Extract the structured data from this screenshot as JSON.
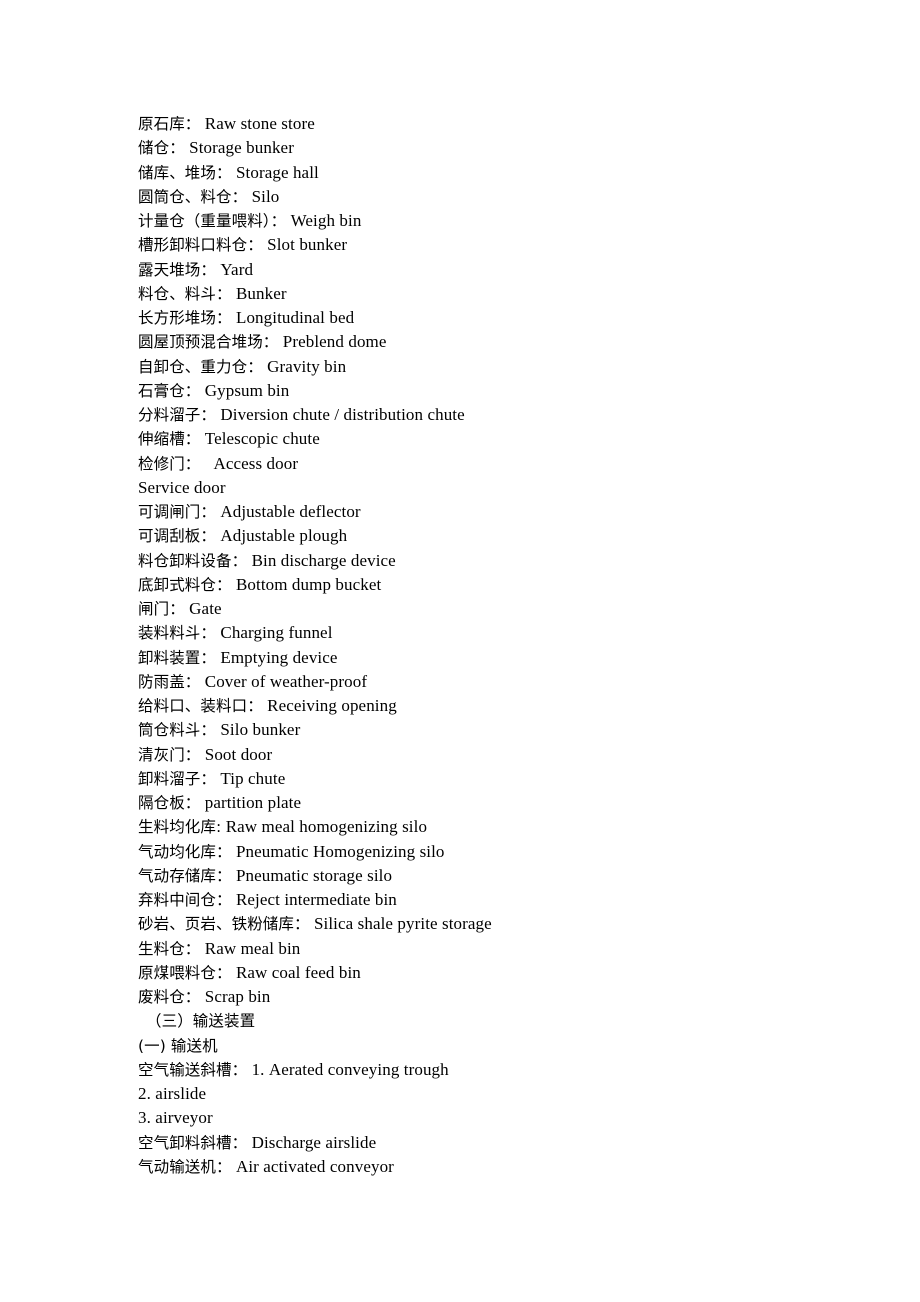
{
  "document": {
    "background_color": "#ffffff",
    "text_color": "#000000",
    "lines": [
      {
        "cn": "原石库：",
        "en": "Raw stone store",
        "indent": false
      },
      {
        "cn": "储仓：",
        "en": "Storage bunker",
        "indent": false
      },
      {
        "cn": "储库、堆场：",
        "en": "Storage hall",
        "indent": false
      },
      {
        "cn": "圆筒仓、料仓：",
        "en": "Silo",
        "indent": false
      },
      {
        "cn": "计量仓（重量喂料）：",
        "en": "Weigh bin",
        "indent": false
      },
      {
        "cn": "槽形卸料口料仓：",
        "en": "Slot bunker",
        "indent": false
      },
      {
        "cn": "露天堆场：",
        "en": "Yard",
        "indent": false
      },
      {
        "cn": "料仓、料斗：",
        "en": "Bunker",
        "indent": false
      },
      {
        "cn": "长方形堆场：",
        "en": "Longitudinal bed",
        "indent": false
      },
      {
        "cn": "圆屋顶预混合堆场：",
        "en": "Preblend dome",
        "indent": false
      },
      {
        "cn": "自卸仓、重力仓：",
        "en": "Gravity bin",
        "indent": false
      },
      {
        "cn": "石膏仓：",
        "en": "Gypsum bin",
        "indent": false
      },
      {
        "cn": "分料溜子：",
        "en": "Diversion chute / distribution chute",
        "indent": false
      },
      {
        "cn": "伸缩槽：",
        "en": "Telescopic chute",
        "indent": false
      },
      {
        "cn": "检修门：",
        "en": "  Access door",
        "indent": false
      },
      {
        "cn": "",
        "en": "Service door",
        "indent": false
      },
      {
        "cn": "可调闸门：",
        "en": "Adjustable deflector",
        "indent": false
      },
      {
        "cn": "可调刮板：",
        "en": "Adjustable plough",
        "indent": false
      },
      {
        "cn": "料仓卸料设备：",
        "en": "Bin discharge device",
        "indent": false
      },
      {
        "cn": "底卸式料仓：",
        "en": "Bottom dump bucket",
        "indent": false
      },
      {
        "cn": "闸门：",
        "en": "Gate",
        "indent": false
      },
      {
        "cn": "装料料斗：",
        "en": "Charging funnel",
        "indent": false
      },
      {
        "cn": "卸料装置：",
        "en": "Emptying device",
        "indent": false
      },
      {
        "cn": "防雨盖：",
        "en": "Cover of weather-proof",
        "indent": false
      },
      {
        "cn": "给料口、装料口：",
        "en": "Receiving opening",
        "indent": false
      },
      {
        "cn": "筒仓料斗：",
        "en": "Silo bunker",
        "indent": false
      },
      {
        "cn": "清灰门：",
        "en": "Soot door",
        "indent": false
      },
      {
        "cn": "卸料溜子：",
        "en": "Tip chute",
        "indent": false
      },
      {
        "cn": "隔仓板：",
        "en": "partition plate",
        "indent": false
      },
      {
        "cn": "生料均化库:",
        "en": "Raw meal homogenizing silo",
        "indent": false
      },
      {
        "cn": "气动均化库：",
        "en": "Pneumatic Homogenizing silo",
        "indent": false
      },
      {
        "cn": "气动存储库：",
        "en": "Pneumatic storage silo",
        "indent": false
      },
      {
        "cn": "弃料中间仓：",
        "en": "Reject intermediate bin",
        "indent": false
      },
      {
        "cn": "砂岩、页岩、铁粉储库：",
        "en": "Silica shale pyrite storage",
        "indent": false
      },
      {
        "cn": "生料仓：",
        "en": "Raw meal bin",
        "indent": false
      },
      {
        "cn": "原煤喂料仓：",
        "en": "Raw coal feed bin",
        "indent": false
      },
      {
        "cn": "废料仓：",
        "en": "Scrap bin",
        "indent": false
      },
      {
        "cn": "（三）输送装置",
        "en": "",
        "indent": true
      },
      {
        "cn": "(一) 输送机",
        "en": "",
        "indent": false
      },
      {
        "cn": "空气输送斜槽：",
        "en": "1. Aerated conveying trough",
        "indent": false
      },
      {
        "cn": "",
        "en": "2. airslide",
        "indent": false
      },
      {
        "cn": "",
        "en": "3. airveyor",
        "indent": false
      },
      {
        "cn": "空气卸料斜槽：",
        "en": "Discharge airslide",
        "indent": false
      },
      {
        "cn": "气动输送机：",
        "en": "Air activated conveyor",
        "indent": false
      }
    ]
  }
}
